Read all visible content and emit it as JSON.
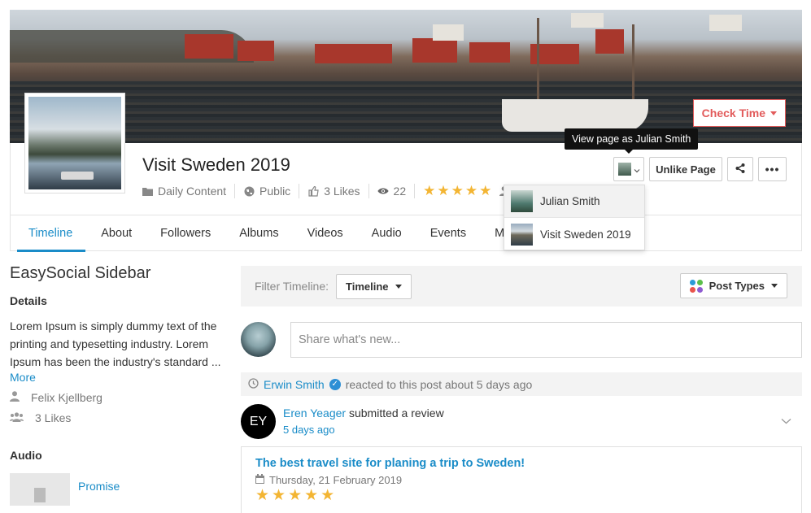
{
  "cover": {
    "check_time_label": "Check Time"
  },
  "profile": {
    "title": "Visit Sweden 2019",
    "category": "Daily Content",
    "privacy": "Public",
    "likes": "3 Likes",
    "views": "22",
    "rating": 5
  },
  "actions": {
    "tooltip": "View page as Julian Smith",
    "unlike_label": "Unlike Page"
  },
  "view_as_menu": {
    "items": [
      {
        "label": "Julian Smith"
      },
      {
        "label": "Visit Sweden 2019"
      }
    ]
  },
  "tabs": [
    {
      "label": "Timeline",
      "active": true
    },
    {
      "label": "About"
    },
    {
      "label": "Followers"
    },
    {
      "label": "Albums"
    },
    {
      "label": "Videos"
    },
    {
      "label": "Audio"
    },
    {
      "label": "Events"
    },
    {
      "label": "M"
    }
  ],
  "sidebar": {
    "title": "EasySocial Sidebar",
    "details_heading": "Details",
    "details_text": "Lorem Ipsum is simply dummy text of the printing and typesetting industry. Lorem Ipsum has been the industry's standard ...",
    "more_label": "More",
    "owner": "Felix Kjellberg",
    "likes": "3 Likes",
    "audio_heading": "Audio",
    "audio_item": "Promise"
  },
  "filter": {
    "label": "Filter Timeline:",
    "timeline_btn": "Timeline",
    "post_types_btn": "Post Types"
  },
  "composer": {
    "placeholder": "Share what's new..."
  },
  "activity": {
    "reactor": "Erwin Smith",
    "reaction_text": "reacted to this post about 5 days ago",
    "author_initials": "EY",
    "author": "Eren Yeager",
    "action": "submitted a review",
    "time": "5 days ago",
    "review_title": "The best travel site for planing a trip to Sweden!",
    "review_date": "Thursday, 21 February 2019",
    "review_rating": 5
  },
  "colors": {
    "accent": "#1a8cc8",
    "check_time": "#e25b5b",
    "star": "#f3b533"
  }
}
